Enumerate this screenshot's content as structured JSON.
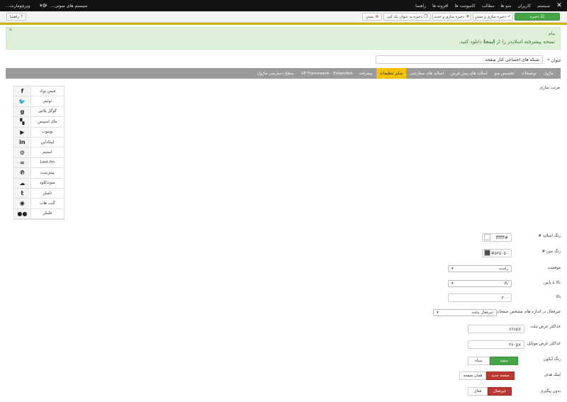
{
  "topnav": {
    "brand_icon": "joomla-icon",
    "menu": [
      "سیستم",
      "کاربران",
      "منو ها",
      "مطالب",
      "کامپوننت ها",
      "افزونه ها",
      "راهنما"
    ],
    "site_name": "سیستم های صوتی…",
    "user_name": "وبرچومارت…"
  },
  "toolbar": {
    "save": "ذخیره",
    "save_close": "ذخیره سازی و بستن",
    "save_new": "ذخیره سازی و جدید",
    "save_copy": "ذخیره به عنوان یک کپی",
    "close": "بستن",
    "help": "راهنما"
  },
  "message": {
    "heading": "پیام",
    "body_prefix": "نسخه پیشرفته اسلایدر را از ",
    "body_link": "اینجا",
    "body_suffix": " دانلود کنید."
  },
  "title_field": {
    "label": "عنوان *",
    "value": "شبکه های اجتماعی کنار صفحه"
  },
  "tabs": [
    "ماژول",
    "توضیحات",
    "تخصیص منو",
    "اسلاید های پیش فرض",
    "اسلاید های سفارشی",
    "سایر تنظیمات",
    "پیشرفته",
    "VP Framework - Extended",
    "سطح دسترسی ماژول"
  ],
  "active_tab": "سایر تنظیمات",
  "order_label": "مرتب سازی",
  "social": [
    {
      "label": "فیس بوک",
      "icon": "f"
    },
    {
      "label": "توئیتر",
      "icon": "🐦"
    },
    {
      "label": "گوگل پلاس",
      "icon": "g"
    },
    {
      "label": "مای اسپیس",
      "icon": "▚"
    },
    {
      "label": "یوتیوب",
      "icon": "▶"
    },
    {
      "label": "لینکداین",
      "icon": "in"
    },
    {
      "label": "استیم",
      "icon": "⚙"
    },
    {
      "label": "Last.fm",
      "icon": "∞"
    },
    {
      "label": "پینترست",
      "icon": "℗"
    },
    {
      "label": "سوندکلود",
      "icon": "☁"
    },
    {
      "label": "تامبلر",
      "icon": "t"
    },
    {
      "label": "گیت هاب",
      "icon": "◉"
    },
    {
      "label": "فلیکر",
      "icon": "●●"
    }
  ],
  "form": {
    "slider_color": {
      "label": "رنگ اسلاید #",
      "value": "#ffffff",
      "swatch": "#ffffff"
    },
    "text_color": {
      "label": "رنگ متن #",
      "value": "#۵۲۵۰۵۰",
      "swatch": "#525050"
    },
    "position": {
      "label": "موقعیت",
      "value": "راست"
    },
    "top_bottom": {
      "label": "بالا یا پایین",
      "value": "بالا"
    },
    "top": {
      "label": "بالا",
      "value": "۳۰۰"
    },
    "disable_pages": {
      "label": "غیرفعال در اندازه های مشخص صفحات",
      "value": "غیرفعال نباشد"
    },
    "max_tablet": {
      "label": "حداکثر عرض تبلت",
      "value": "۷۶۸px"
    },
    "max_mobile": {
      "label": "حداکثر عرض موبایل",
      "value": "۴۸۰px"
    },
    "icon_color": {
      "label": "رنگ آیکون",
      "options": [
        "سفید",
        "سیاه"
      ]
    },
    "link_target": {
      "label": "لینک هدف",
      "options": [
        "صفحه جدید",
        "همان صفحه"
      ]
    },
    "no_tracking": {
      "label": "بدون پیگیری",
      "options": [
        "غیرفعال",
        "فعال"
      ]
    }
  },
  "colors": {
    "accent_green": "#46a546",
    "accent_red": "#bd362f",
    "tab_active": "#f2c200",
    "topbar": "#121212"
  }
}
